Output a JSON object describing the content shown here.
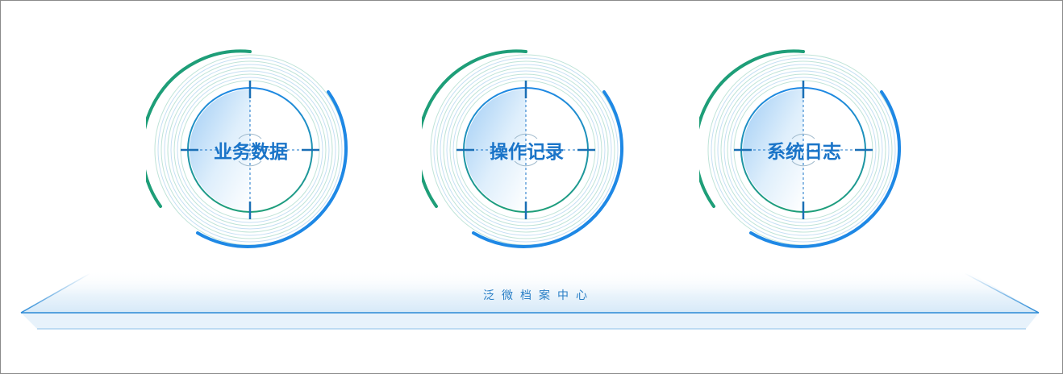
{
  "modules": [
    {
      "label": "业务数据",
      "icon": "target-ring-icon"
    },
    {
      "label": "操作记录",
      "icon": "target-ring-icon"
    },
    {
      "label": "系统日志",
      "icon": "target-ring-icon"
    }
  ],
  "platform": {
    "title": "泛微档案中心"
  },
  "colors": {
    "blue": "#1e88e5",
    "green": "#1e9e78",
    "label": "#1a74c8",
    "platform_edge": "#2a8ad6"
  }
}
